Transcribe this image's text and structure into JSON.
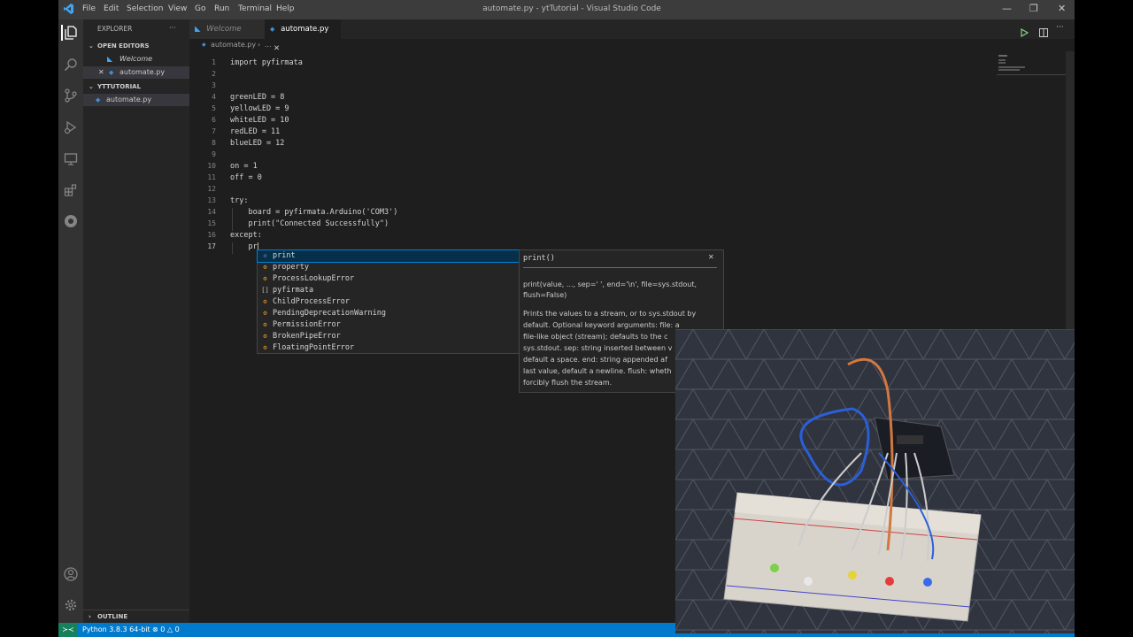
{
  "window": {
    "title": "automate.py - ytTutorial - Visual Studio Code",
    "menu": [
      "File",
      "Edit",
      "Selection",
      "View",
      "Go",
      "Run",
      "Terminal",
      "Help"
    ],
    "controls": [
      "—",
      "❐",
      "✕"
    ]
  },
  "sidebar": {
    "header": "EXPLORER",
    "more": "···",
    "open_editors_title": "OPEN EDITORS",
    "open_editors": [
      {
        "label": "Welcome",
        "close": ""
      },
      {
        "label": "automate.py",
        "close": "✕"
      }
    ],
    "folder_title": "YTTUTORIAL",
    "files": [
      "automate.py"
    ],
    "outline_title": "OUTLINE"
  },
  "tabs": [
    {
      "label": "Welcome",
      "close": ""
    },
    {
      "label": "automate.py",
      "close": "✕"
    }
  ],
  "breadcrumb": {
    "file": "automate.py",
    "sep": "›",
    "more": "..."
  },
  "editor": {
    "line_numbers": [
      "1",
      "2",
      "3",
      "4",
      "5",
      "6",
      "7",
      "8",
      "9",
      "10",
      "11",
      "12",
      "13",
      "14",
      "15",
      "16",
      "17"
    ],
    "lines": [
      "import pyfirmata",
      "",
      "",
      "greenLED = 8",
      "yellowLED = 9",
      "whiteLED = 10",
      "redLED = 11",
      "blueLED = 12",
      "",
      "on = 1",
      "off = 0",
      "",
      "try:",
      "    board = pyfirmata.Arduino('COM3')",
      "    print(\"Connected Successfully\")",
      "except:",
      "    pr"
    ]
  },
  "suggestions": [
    {
      "label": "print",
      "kind": "function",
      "icon": "◇"
    },
    {
      "label": "property",
      "kind": "class",
      "icon": "⚙"
    },
    {
      "label": "ProcessLookupError",
      "kind": "class",
      "icon": "⚙"
    },
    {
      "label": "pyfirmata",
      "kind": "module",
      "icon": "[]"
    },
    {
      "label": "ChildProcessError",
      "kind": "class",
      "icon": "⚙"
    },
    {
      "label": "PendingDeprecationWarning",
      "kind": "class",
      "icon": "⚙"
    },
    {
      "label": "PermissionError",
      "kind": "class",
      "icon": "⚙"
    },
    {
      "label": "BrokenPipeError",
      "kind": "class",
      "icon": "⚙"
    },
    {
      "label": "FloatingPointError",
      "kind": "class",
      "icon": "⚙"
    }
  ],
  "detail": {
    "title": "print()",
    "close": "✕",
    "signature": "print(value, ..., sep=' ', end='\\n', file=sys.stdout, flush=False)",
    "doc_lines": [
      "Prints the values to a stream, or to sys.stdout by",
      "default. Optional keyword arguments: file: a",
      "file-like object (stream); defaults to the c",
      "sys.stdout. sep: string inserted between v",
      "default a space. end: string appended af",
      "last value, default a newline. flush: wheth",
      "forcibly flush the stream."
    ]
  },
  "status": {
    "interpreter": "Python 3.8.3 64-bit",
    "errors": "0",
    "warnings": "0"
  },
  "colors": {
    "accent": "#007acc",
    "editor_bg": "#1e1e1e",
    "sidebar_bg": "#252526",
    "titlebar_bg": "#3c3c3c"
  }
}
